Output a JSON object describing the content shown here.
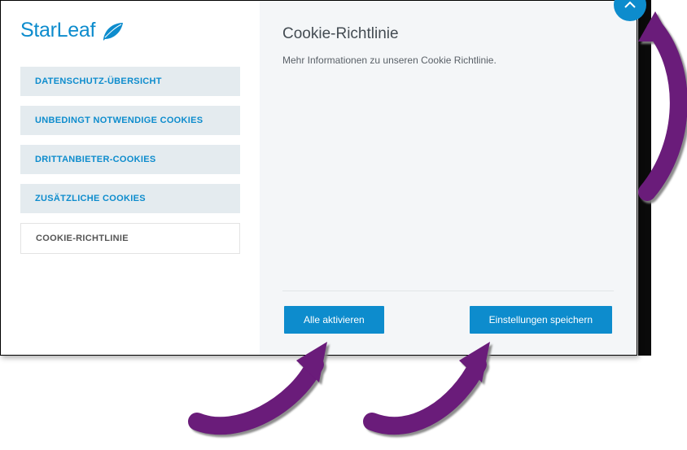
{
  "logo": {
    "name": "StarLeaf"
  },
  "sidebar": {
    "items": [
      {
        "label": "DATENSCHUTZ-ÜBERSICHT"
      },
      {
        "label": "UNBEDINGT NOTWENDIGE COOKIES"
      },
      {
        "label": "DRITTANBIETER-COOKIES"
      },
      {
        "label": "ZUSÄTZLICHE COOKIES"
      },
      {
        "label": "COOKIE-RICHTLINIE"
      }
    ],
    "active_index": 4
  },
  "main": {
    "title": "Cookie-Richtlinie",
    "description": "Mehr Informationen zu unseren Cookie Richtlinie."
  },
  "buttons": {
    "enable_all": "Alle aktivieren",
    "save": "Einstellungen speichern"
  },
  "colors": {
    "brand": "#0d8ccd",
    "sidebar_item_bg": "#e4ebef",
    "main_bg": "#f4f6f8",
    "annotation": "#6b1a7a"
  }
}
